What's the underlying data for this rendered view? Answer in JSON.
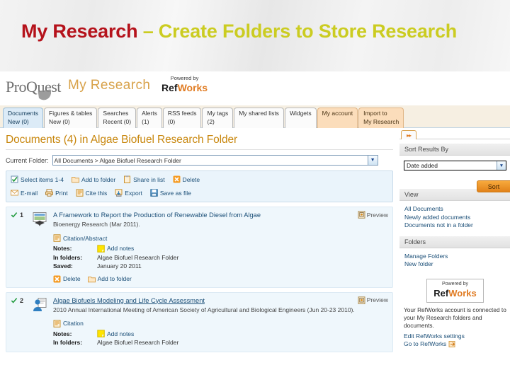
{
  "slide": {
    "title_red": "My Research",
    "title_rest": " – Create Folders to Store Research",
    "title_color_red": "#b5121b",
    "title_color_olive": "#cbcc21"
  },
  "brand": {
    "proquest": "ProQuest",
    "product": "My Research",
    "refworks_powered": "Powered by",
    "refworks_ref": "Ref",
    "refworks_works": "Works"
  },
  "tabs": [
    {
      "line1": "Documents",
      "line2": "New (0)",
      "state": "active"
    },
    {
      "line1": "Figures & tables",
      "line2": "New (0)",
      "state": "normal"
    },
    {
      "line1": "Searches",
      "line2": "Recent (0)",
      "state": "normal"
    },
    {
      "line1": "Alerts",
      "line2": "(1)",
      "state": "normal"
    },
    {
      "line1": "RSS feeds",
      "line2": "(0)",
      "state": "normal"
    },
    {
      "line1": "My tags",
      "line2": "(2)",
      "state": "normal"
    },
    {
      "line1": "My shared lists",
      "line2": "",
      "state": "normal"
    },
    {
      "line1": "Widgets",
      "line2": "",
      "state": "normal"
    },
    {
      "line1": "My account",
      "line2": "",
      "state": "warm"
    },
    {
      "line1": "Import to",
      "line2": "My Research",
      "state": "warm"
    }
  ],
  "main": {
    "page_title": "Documents (4) in Algae Biofuel Research Folder",
    "folder_label": "Current Folder:",
    "folder_value": "All Documents > Algae Biofuel Research Folder",
    "toolbar_row1": [
      {
        "label": "Select items 1-4",
        "icon": "checkbox-icon"
      },
      {
        "label": "Add to folder",
        "icon": "folder-icon"
      },
      {
        "label": "Share in list",
        "icon": "clipboard-icon"
      },
      {
        "label": "Delete",
        "icon": "delete-x-icon"
      }
    ],
    "toolbar_row2": [
      {
        "label": "E-mail",
        "icon": "envelope-icon"
      },
      {
        "label": "Print",
        "icon": "printer-icon"
      },
      {
        "label": "Cite this",
        "icon": "cite-icon"
      },
      {
        "label": "Export",
        "icon": "export-icon"
      },
      {
        "label": "Save as file",
        "icon": "save-icon"
      }
    ],
    "preview_label": "Preview",
    "results": [
      {
        "num": "1",
        "title": "A Framework to Report the Production of Renewable Diesel from Algae",
        "source": "Bioenergy Research (Mar 2011).",
        "doc_link": "Citation/Abstract",
        "notes_key": "Notes:",
        "notes_link": "Add notes",
        "folders_key": "In folders:",
        "folders_value": "Algae Biofuel Research Folder",
        "saved_key": "Saved:",
        "saved_value": "January 20 2011",
        "action_delete": "Delete",
        "action_add": "Add to folder",
        "linked": false
      },
      {
        "num": "2",
        "title": "Algae Biofuels Modeling and Life Cycle Assessment",
        "source": "2010 Annual International Meeting of American Society of Agricultural and Biological Engineers (Jun 20-23 2010).",
        "doc_link": "Citation",
        "notes_key": "Notes:",
        "notes_link": "Add notes",
        "folders_key": "In folders:",
        "folders_value": "Algae Biofuel Research Folder",
        "linked": true
      }
    ]
  },
  "sidebar": {
    "collapse_glyph": "▸▸",
    "sort_heading": "Sort Results By",
    "sort_value": "Date added",
    "sort_button": "Sort",
    "view_heading": "View",
    "view_links": [
      "All Documents",
      "Newly added documents",
      "Documents not in a folder"
    ],
    "folders_heading": "Folders",
    "folders_links": [
      "Manage Folders",
      "New folder"
    ],
    "refworks_powered": "Powered by",
    "refworks_ref": "Ref",
    "refworks_works": "Works",
    "refworks_text": "Your RefWorks account is connected to your My Research folders and documents.",
    "refworks_links": [
      "Edit RefWorks settings",
      "Go to RefWorks"
    ]
  }
}
